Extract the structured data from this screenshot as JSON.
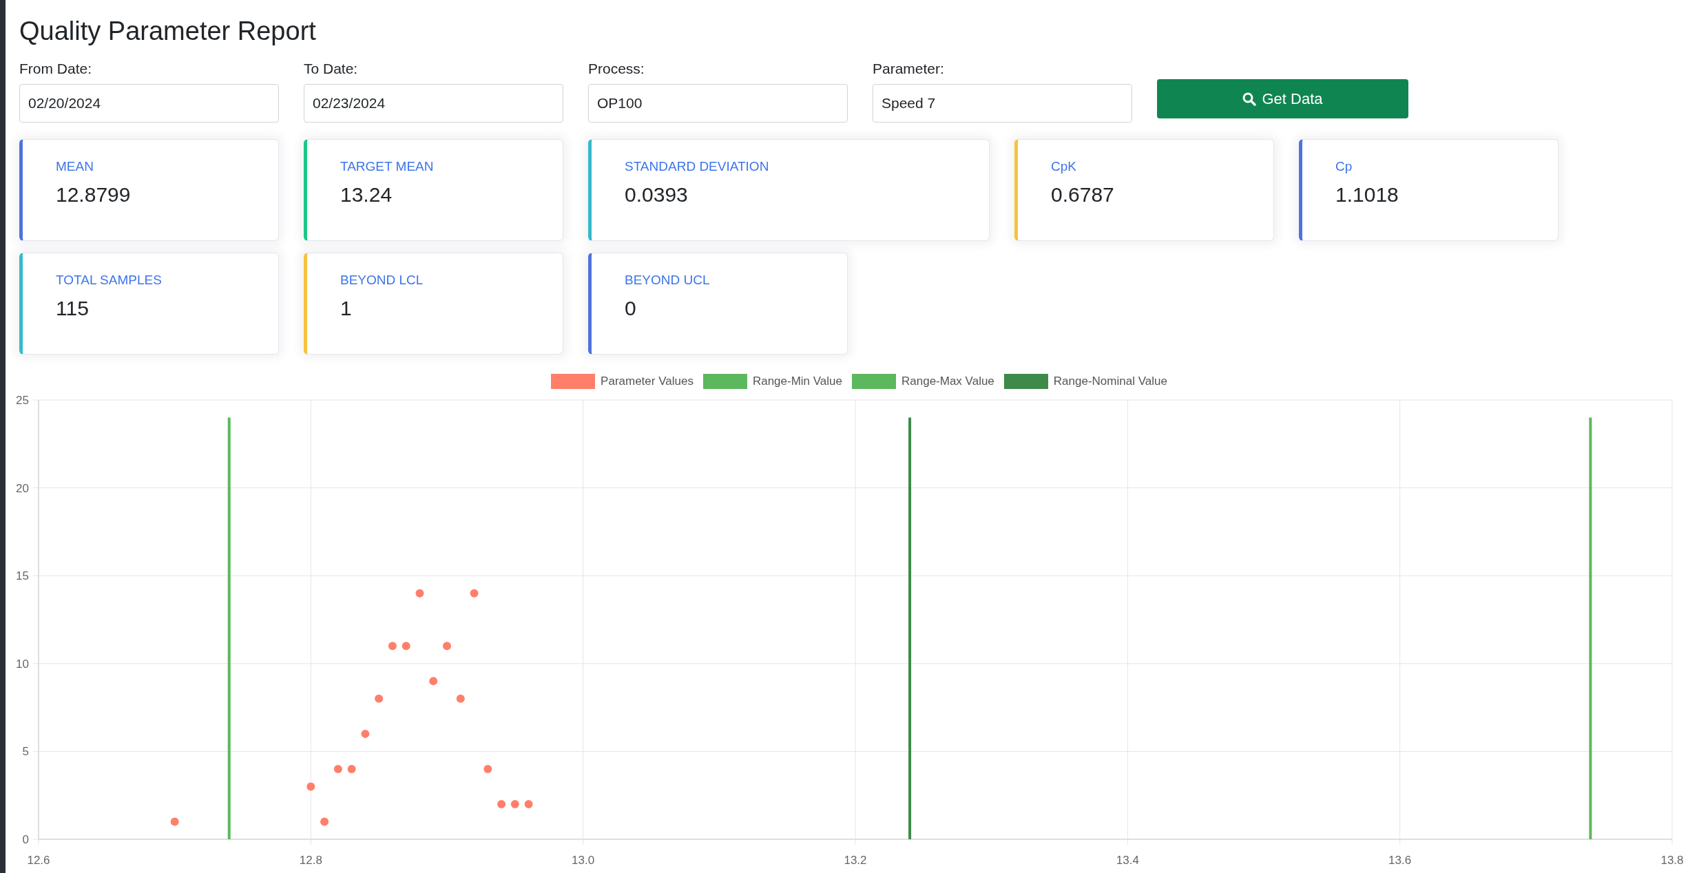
{
  "title": "Quality Parameter Report",
  "filters": [
    {
      "label": "From Date:",
      "value": "02/20/2024"
    },
    {
      "label": "To Date:",
      "value": "02/23/2024"
    },
    {
      "label": "Process:",
      "value": "OP100"
    },
    {
      "label": "Parameter:",
      "value": "Speed 7"
    }
  ],
  "get_data_button": {
    "label": "Get Data"
  },
  "stats": [
    [
      {
        "label": "MEAN",
        "value": "12.8799",
        "color": "#4e73df"
      },
      {
        "label": "TARGET MEAN",
        "value": "13.24",
        "color": "#1cc88a"
      },
      {
        "label": "STANDARD DEVIATION",
        "value": "0.0393",
        "color": "#36b9cc"
      },
      {
        "label": "CpK",
        "value": "0.6787",
        "color": "#f6c23e"
      },
      {
        "label": "Cp",
        "value": "1.1018",
        "color": "#4e73df"
      }
    ],
    [
      {
        "label": "TOTAL SAMPLES",
        "value": "115",
        "color": "#36b9cc"
      },
      {
        "label": "BEYOND LCL",
        "value": "1",
        "color": "#f6c23e"
      },
      {
        "label": "BEYOND UCL",
        "value": "0",
        "color": "#4e73df"
      }
    ]
  ],
  "chart": {
    "chart_data": {
      "type": "scatter",
      "xlim": [
        12.6,
        13.8
      ],
      "ylim": [
        0,
        25
      ],
      "xticks": [
        {
          "value": 12.6,
          "label": "12.6"
        },
        {
          "value": 12.8,
          "label": "12.8"
        },
        {
          "value": 13.0,
          "label": "13.0"
        },
        {
          "value": 13.2,
          "label": "13.2"
        },
        {
          "value": 13.4,
          "label": "13.4"
        },
        {
          "value": 13.6,
          "label": "13.6"
        },
        {
          "value": 13.8,
          "label": "13.8"
        }
      ],
      "yticks": [
        {
          "value": 0,
          "label": "0"
        },
        {
          "value": 5,
          "label": "5"
        },
        {
          "value": 10,
          "label": "10"
        },
        {
          "value": 15,
          "label": "15"
        },
        {
          "value": 20,
          "label": "20"
        },
        {
          "value": 25,
          "label": "25"
        }
      ],
      "x": [
        12.7,
        12.8,
        12.81,
        12.82,
        12.83,
        12.84,
        12.85,
        12.86,
        12.87,
        12.88,
        12.89,
        12.9,
        12.91,
        12.92,
        12.93,
        12.94,
        12.95,
        12.96
      ],
      "series": [
        {
          "name": "Parameter Values",
          "color": "#ff7f6b",
          "values": [
            1,
            3,
            1,
            4,
            4,
            6,
            8,
            11,
            11,
            14,
            9,
            11,
            8,
            14,
            4,
            2,
            2,
            2
          ]
        }
      ],
      "ref_lines": [
        {
          "label": "Range-Min Value",
          "color": "#5cb85c",
          "axis": "x",
          "value": 12.74
        },
        {
          "label": "Range-Max Value",
          "color": "#5cb85c",
          "axis": "x",
          "value": 13.74
        },
        {
          "label": "Range-Nominal Value",
          "color": "#3d8a4a",
          "axis": "x",
          "value": 13.24
        }
      ],
      "grid": true
    }
  }
}
